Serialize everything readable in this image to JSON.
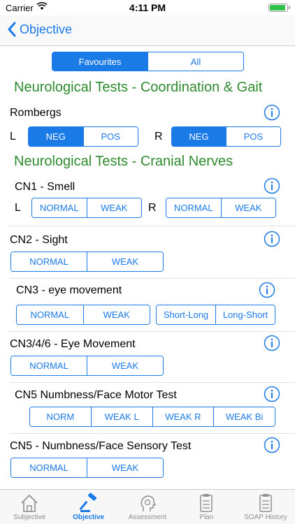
{
  "status_bar": {
    "carrier": "Carrier",
    "time": "4:11 PM",
    "battery_level": 0.9
  },
  "nav": {
    "back_label": "Objective"
  },
  "filter": {
    "options": [
      "Favourites",
      "All"
    ],
    "selected": "Favourites"
  },
  "sections": [
    {
      "title": "Neurological Tests - Coordination & Gait"
    },
    {
      "title": "Neurological Tests - Cranial Nerves"
    }
  ],
  "tests": {
    "rombergs": {
      "label": "Rombergs",
      "left_side": "L",
      "right_side": "R",
      "options": [
        "NEG",
        "POS"
      ],
      "left_selected": "NEG",
      "right_selected": "NEG"
    },
    "cn1": {
      "label": "CN1 - Smell",
      "left_side": "L",
      "right_side": "R",
      "options": [
        "NORMAL",
        "WEAK"
      ]
    },
    "cn2": {
      "label": "CN2 - Sight",
      "options": [
        "NORMAL",
        "WEAK"
      ]
    },
    "cn3": {
      "label": "CN3 -  eye movement",
      "options": [
        "NORMAL",
        "WEAK"
      ],
      "direction_options": [
        "Short-Long",
        "Long-Short"
      ]
    },
    "cn346": {
      "label": "CN3/4/6 -  Eye Movement",
      "options": [
        "NORMAL",
        "WEAK"
      ]
    },
    "cn5_motor": {
      "label": "CN5 Numbness/Face Motor Test",
      "options": [
        "NORM",
        "WEAK L",
        "WEAK R",
        "WEAK Bi"
      ]
    },
    "cn5_sensory": {
      "label": "CN5 - Numbness/Face Sensory Test",
      "options": [
        "NORMAL",
        "WEAK"
      ]
    }
  },
  "tabbar": {
    "tabs": [
      {
        "label": "Subjective",
        "icon": "house-icon"
      },
      {
        "label": "Objective",
        "icon": "gavel-icon"
      },
      {
        "label": "Assessment",
        "icon": "head-icon"
      },
      {
        "label": "Plan",
        "icon": "clipboard-icon"
      },
      {
        "label": "SOAP History",
        "icon": "clipboard-icon"
      }
    ],
    "active": "Objective"
  },
  "colors": {
    "accent": "#1a7ae6",
    "section_title": "#2e8b2e"
  }
}
